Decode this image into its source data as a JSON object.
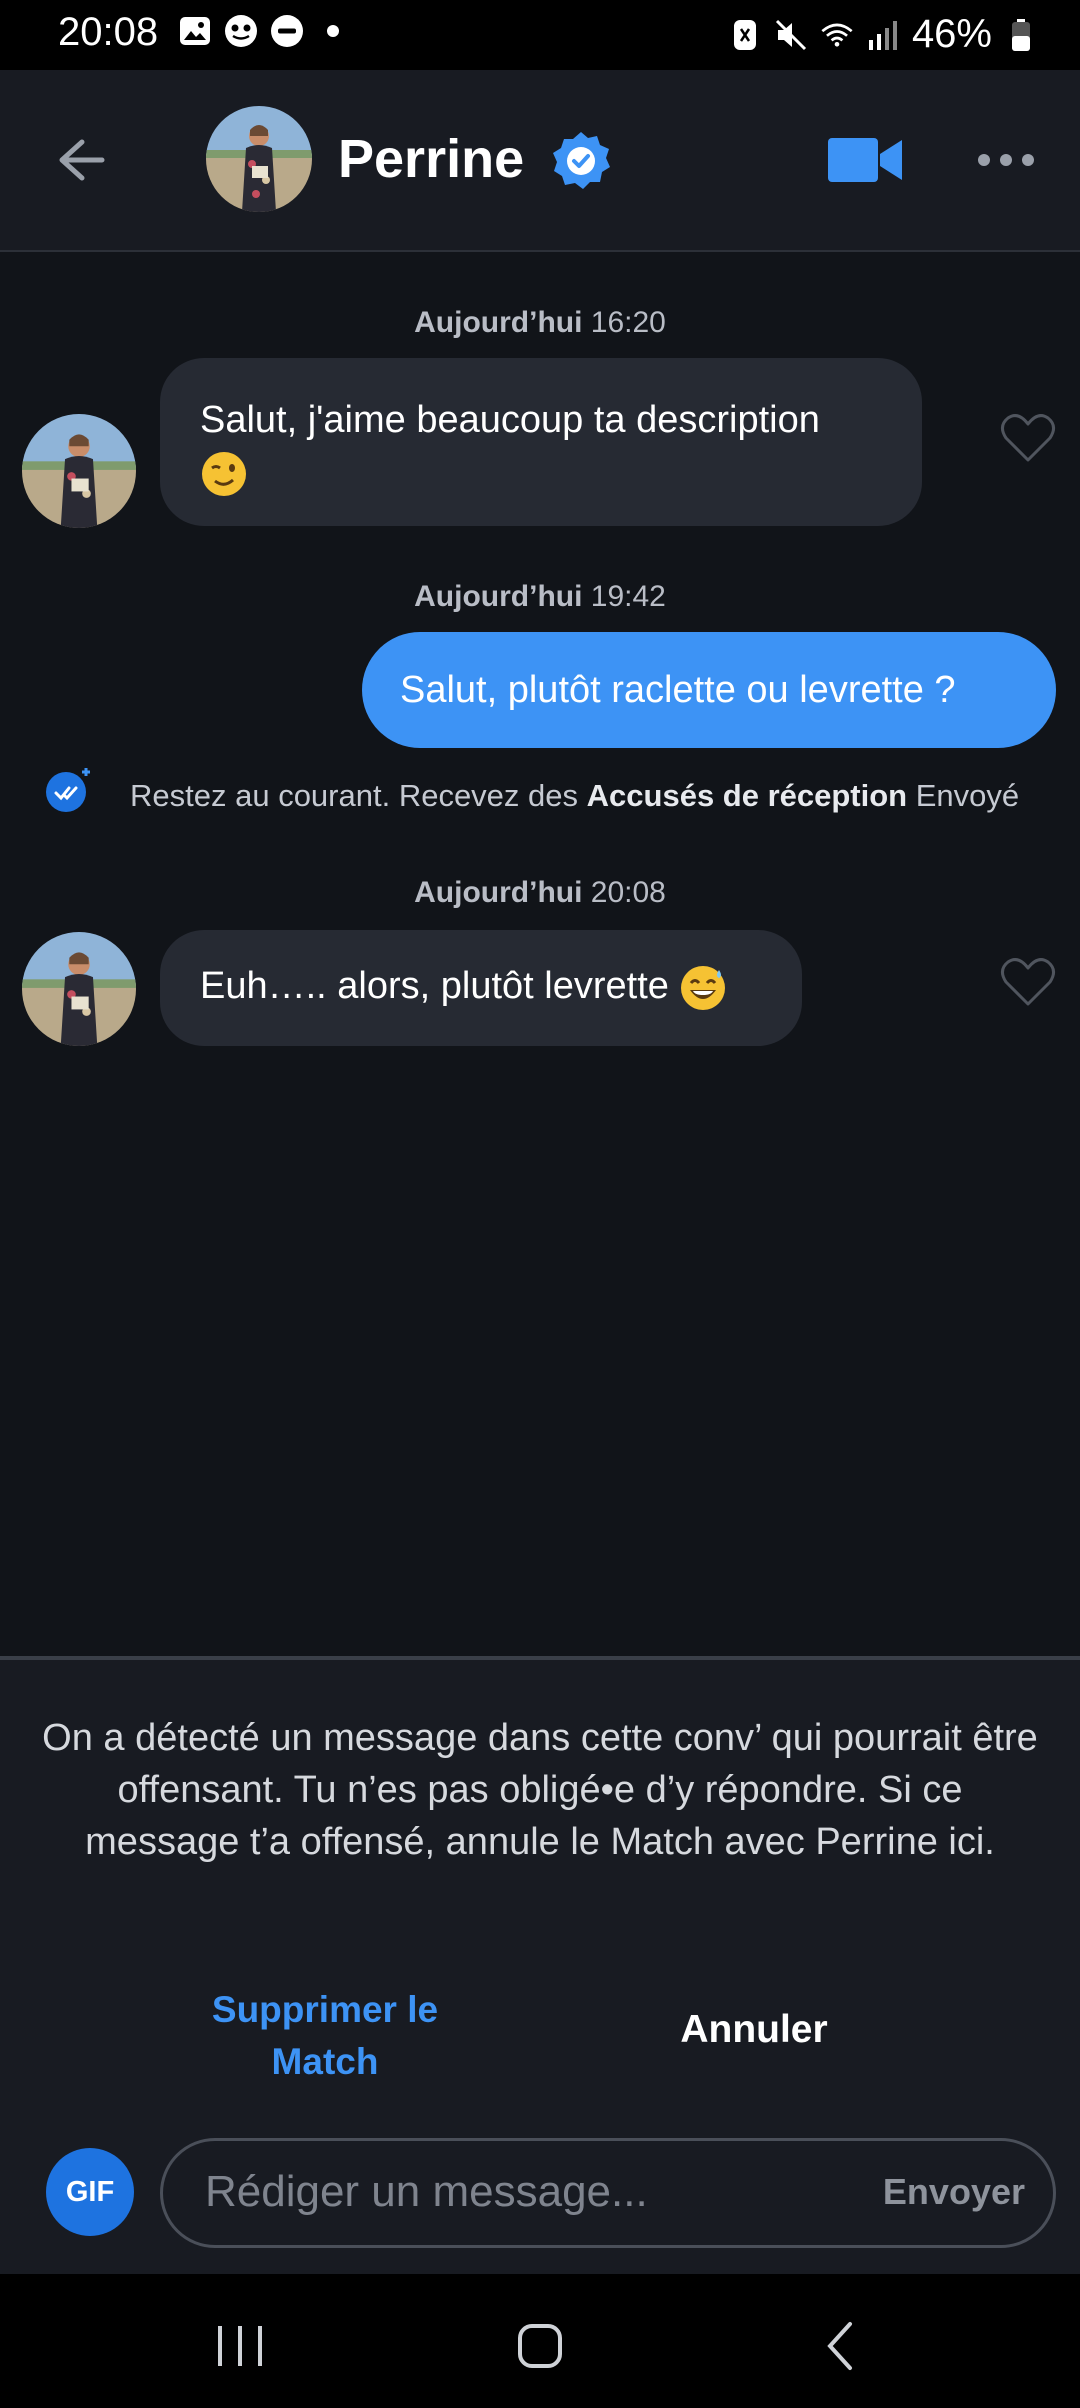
{
  "status_bar": {
    "time": "20:08",
    "battery": "46%",
    "icons": [
      "gallery-icon",
      "app-icon",
      "dnd-icon",
      "dot-icon",
      "nfc-icon",
      "mute-icon",
      "wifi-icon",
      "signal-icon",
      "battery-icon"
    ]
  },
  "header": {
    "name": "Perrine",
    "verified": true,
    "icons": [
      "back-arrow-icon",
      "verified-badge-icon",
      "video-call-icon",
      "more-icon"
    ]
  },
  "messages": [
    {
      "timestamp_prefix": "Aujourd’hui",
      "timestamp_time": "16:20",
      "direction": "incoming",
      "text": "Salut, j'aime beaucoup ta description",
      "emoji": "winking-face"
    },
    {
      "timestamp_prefix": "Aujourd’hui",
      "timestamp_time": "19:42",
      "direction": "outgoing",
      "text": "Salut, plutôt raclette ou levrette ?"
    },
    {
      "timestamp_prefix": "Aujourd’hui",
      "timestamp_time": "20:08",
      "direction": "incoming",
      "text": "Euh….. alors, plutôt levrette",
      "emoji": "grinning-sweat-face"
    }
  ],
  "receipt": {
    "prefix": "Restez au courant. Recevez des",
    "bold": "Accusés de réception",
    "status": "Envoyé"
  },
  "banner": {
    "text": "On a détecté un message dans cette conv’ qui pourrait être offensant. Tu n’es pas obligé•e d’y répondre. Si ce message t’a offensé, annule le Match avec Perrine ici.",
    "delete_line1": "Supprimer le",
    "delete_line2": "Match",
    "cancel": "Annuler"
  },
  "composer": {
    "gif": "GIF",
    "placeholder": "Rédiger un message...",
    "send": "Envoyer"
  },
  "colors": {
    "background": "#111419",
    "accent": "#3d93f5",
    "incoming_bubble": "#262a33"
  }
}
